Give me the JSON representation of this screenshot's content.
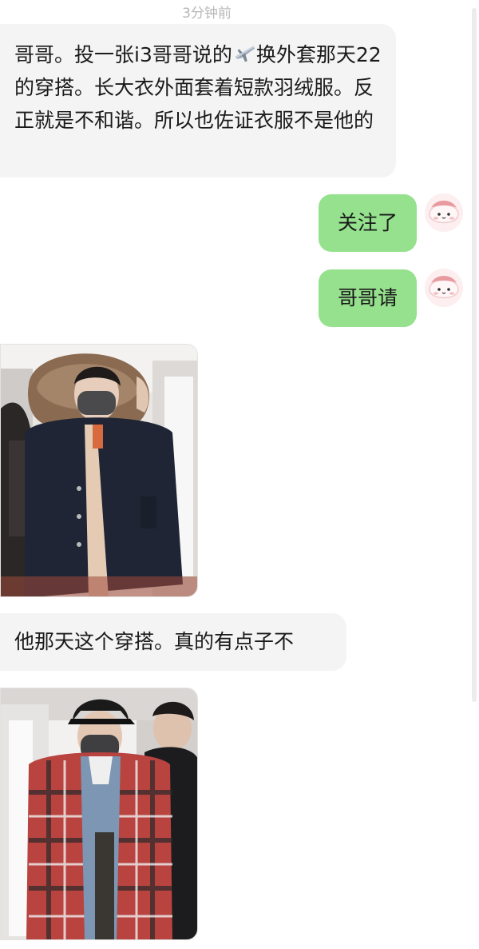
{
  "timestamp": "3分钟前",
  "messages": {
    "incoming_1": {
      "before_emoji": "哥哥。投一张i3哥哥说的",
      "emoji": "airplane-icon",
      "after_emoji": "换外套那天22的穿搭。长大衣外面套着短款羽绒服。反正就是不和谐。所以也佐证衣服不是他的"
    },
    "outgoing_1": "关注了",
    "outgoing_2": "哥哥请",
    "incoming_2": "他那天这个穿搭。真的有点子不对。"
  },
  "colors": {
    "incoming_bubble": "#f4f4f4",
    "outgoing_bubble": "#95e18d",
    "timestamp_text": "#b7b7b7"
  }
}
